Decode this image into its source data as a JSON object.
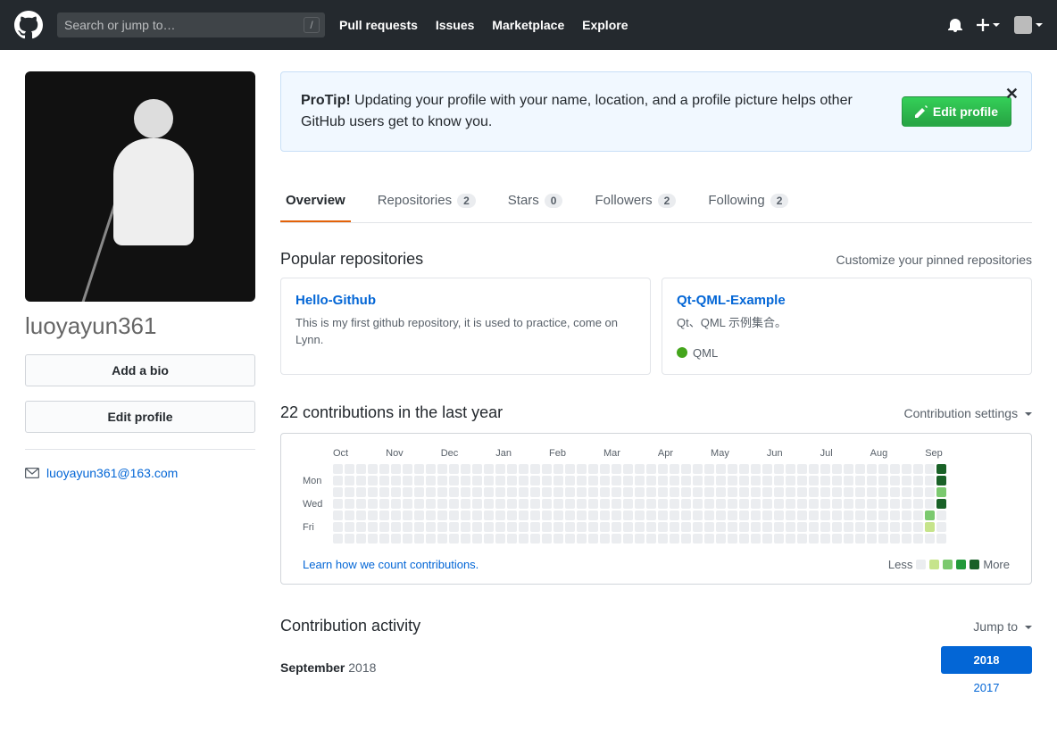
{
  "header": {
    "search_placeholder": "Search or jump to…",
    "slash": "/",
    "nav": [
      "Pull requests",
      "Issues",
      "Marketplace",
      "Explore"
    ]
  },
  "profile": {
    "username": "luoyayun361",
    "add_bio": "Add a bio",
    "edit_profile": "Edit profile",
    "email": "luoyayun361@163.com"
  },
  "protip": {
    "label": "ProTip!",
    "text": "Updating your profile with your name, location, and a profile picture helps other GitHub users get to know you.",
    "button": "Edit profile"
  },
  "tabs": [
    {
      "label": "Overview",
      "count": null,
      "active": true
    },
    {
      "label": "Repositories",
      "count": "2"
    },
    {
      "label": "Stars",
      "count": "0"
    },
    {
      "label": "Followers",
      "count": "2"
    },
    {
      "label": "Following",
      "count": "2"
    }
  ],
  "popular": {
    "title": "Popular repositories",
    "customize": "Customize your pinned repositories",
    "repos": [
      {
        "name": "Hello-Github",
        "desc": "This is my first github repository, it is used to practice, come on Lynn.",
        "lang": null
      },
      {
        "name": "Qt-QML-Example",
        "desc": "Qt、QML 示例集合。",
        "lang": "QML"
      }
    ]
  },
  "contrib": {
    "title": "22 contributions in the last year",
    "settings": "Contribution settings",
    "months": [
      "Oct",
      "Nov",
      "Dec",
      "Jan",
      "Feb",
      "Mar",
      "Apr",
      "May",
      "Jun",
      "Jul",
      "Aug",
      "Sep"
    ],
    "days": [
      "Mon",
      "Wed",
      "Fri"
    ],
    "learn": "Learn how we count contributions.",
    "less": "Less",
    "more": "More"
  },
  "activity": {
    "title": "Contribution activity",
    "jump": "Jump to",
    "month": "September",
    "year": "2018",
    "years": [
      "2018",
      "2017"
    ]
  }
}
